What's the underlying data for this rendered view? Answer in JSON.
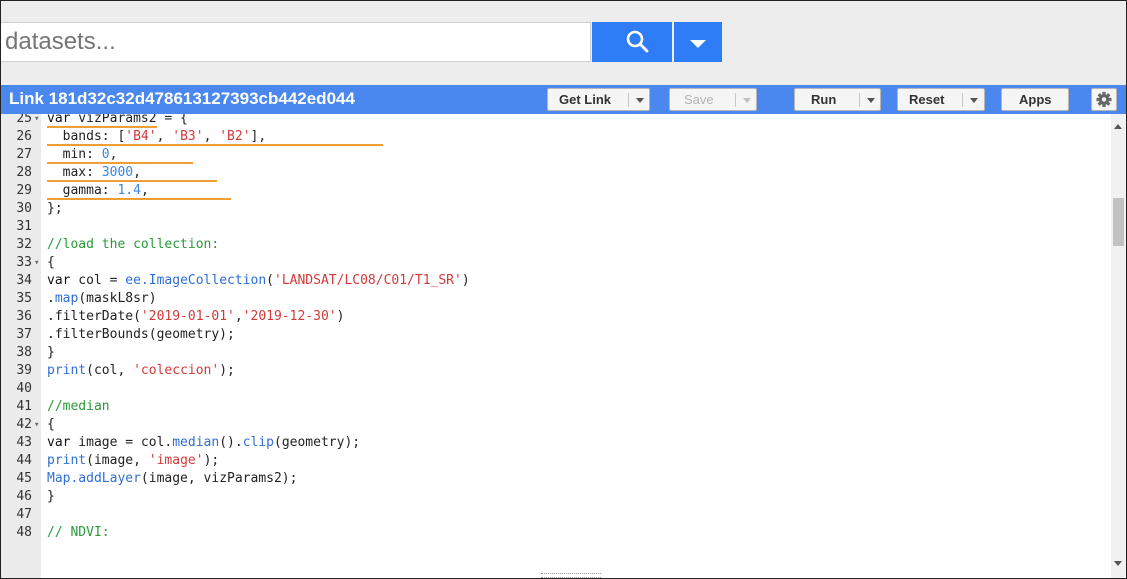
{
  "search": {
    "placeholder": "datasets...",
    "value": ""
  },
  "header": {
    "title": "Link 181d32c32d478613127393cb442ed044",
    "get_link_label": "Get Link",
    "save_label": "Save",
    "run_label": "Run",
    "reset_label": "Reset",
    "apps_label": "Apps"
  },
  "colors": {
    "accent": "#4a87ee",
    "search_button": "#2e7cf6"
  },
  "icons": {
    "search": "search-icon",
    "dropdown": "chevron-down-icon",
    "settings": "gear-icon"
  },
  "editor": {
    "lines": [
      {
        "n": "25",
        "fold": true,
        "tokens": [
          [
            "kw",
            "var"
          ],
          [
            "p",
            " vizParams2 = {"
          ]
        ]
      },
      {
        "n": "26",
        "tokens": [
          [
            "p",
            "  bands: ["
          ],
          [
            "str",
            "'B4'"
          ],
          [
            "p",
            ", "
          ],
          [
            "str",
            "'B3'"
          ],
          [
            "p",
            ", "
          ],
          [
            "str",
            "'B2'"
          ],
          [
            "p",
            "],"
          ]
        ]
      },
      {
        "n": "27",
        "tokens": [
          [
            "p",
            "  min: "
          ],
          [
            "num",
            "0"
          ],
          [
            "p",
            ","
          ]
        ]
      },
      {
        "n": "28",
        "tokens": [
          [
            "p",
            "  max: "
          ],
          [
            "num",
            "3000"
          ],
          [
            "p",
            ","
          ]
        ]
      },
      {
        "n": "29",
        "tokens": [
          [
            "p",
            "  gamma: "
          ],
          [
            "num",
            "1.4"
          ],
          [
            "p",
            ","
          ]
        ]
      },
      {
        "n": "30",
        "tokens": [
          [
            "p",
            "};"
          ]
        ]
      },
      {
        "n": "31",
        "tokens": []
      },
      {
        "n": "32",
        "tokens": [
          [
            "cm",
            "//load the collection:"
          ]
        ]
      },
      {
        "n": "33",
        "fold": true,
        "tokens": [
          [
            "p",
            "{"
          ]
        ]
      },
      {
        "n": "34",
        "tokens": [
          [
            "kw",
            "var"
          ],
          [
            "p",
            " col = "
          ],
          [
            "fn",
            "ee.ImageCollection"
          ],
          [
            "p",
            "("
          ],
          [
            "str",
            "'LANDSAT/LC08/C01/T1_SR'"
          ],
          [
            "p",
            ")"
          ]
        ]
      },
      {
        "n": "35",
        "tokens": [
          [
            "p",
            "."
          ],
          [
            "fn",
            "map"
          ],
          [
            "p",
            "(maskL8sr)"
          ]
        ]
      },
      {
        "n": "36",
        "tokens": [
          [
            "p",
            ".filterDate("
          ],
          [
            "str",
            "'2019-01-01'"
          ],
          [
            "p",
            ","
          ],
          [
            "str",
            "'2019-12-30'"
          ],
          [
            "p",
            ")"
          ]
        ]
      },
      {
        "n": "37",
        "tokens": [
          [
            "p",
            ".filterBounds(geometry);"
          ]
        ]
      },
      {
        "n": "38",
        "tokens": [
          [
            "p",
            "}"
          ]
        ]
      },
      {
        "n": "39",
        "tokens": [
          [
            "fn",
            "print"
          ],
          [
            "p",
            "(col, "
          ],
          [
            "str",
            "'coleccion'"
          ],
          [
            "p",
            ");"
          ]
        ]
      },
      {
        "n": "40",
        "tokens": []
      },
      {
        "n": "41",
        "tokens": [
          [
            "cm",
            "//median"
          ]
        ]
      },
      {
        "n": "42",
        "fold": true,
        "tokens": [
          [
            "p",
            "{"
          ]
        ]
      },
      {
        "n": "43",
        "tokens": [
          [
            "kw",
            "var"
          ],
          [
            "p",
            " image = col."
          ],
          [
            "fn",
            "median"
          ],
          [
            "p",
            "()."
          ],
          [
            "fn",
            "clip"
          ],
          [
            "p",
            "(geometry);"
          ]
        ]
      },
      {
        "n": "44",
        "tokens": [
          [
            "fn",
            "print"
          ],
          [
            "p",
            "(image, "
          ],
          [
            "str",
            "'image'"
          ],
          [
            "p",
            ");"
          ]
        ]
      },
      {
        "n": "45",
        "tokens": [
          [
            "fn",
            "Map.addLayer"
          ],
          [
            "p",
            "(image, vizParams2);"
          ]
        ]
      },
      {
        "n": "46",
        "tokens": [
          [
            "p",
            "}"
          ]
        ]
      },
      {
        "n": "47",
        "tokens": []
      },
      {
        "n": "48",
        "tokens": [
          [
            "cm",
            "// NDVI:"
          ]
        ]
      }
    ]
  }
}
